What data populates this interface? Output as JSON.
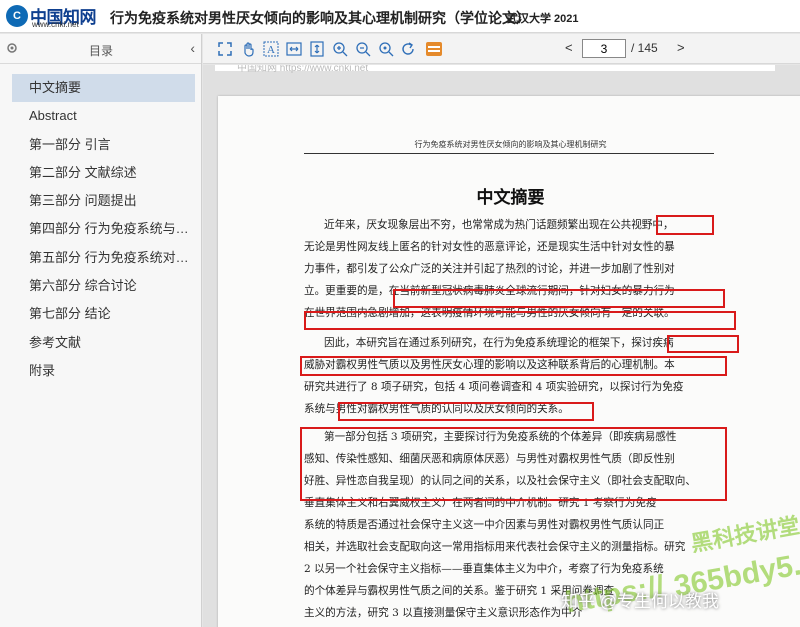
{
  "app": {
    "logo_text": "CNKi",
    "logo_brand": "中国知网",
    "logo_url": "www.cnki.net",
    "title": "行为免疫系统对男性厌女倾向的影响及其心理机制研究（学位论文）",
    "meta": "武汉大学 2021"
  },
  "sidebar": {
    "title": "目录",
    "items": [
      {
        "label": "中文摘要",
        "active": true,
        "expandable": false
      },
      {
        "label": "Abstract",
        "active": false,
        "expandable": false
      },
      {
        "label": "第一部分 引言",
        "active": false,
        "expandable": true
      },
      {
        "label": "第二部分 文献综述",
        "active": false,
        "expandable": true
      },
      {
        "label": "第三部分 问题提出",
        "active": false,
        "expandable": true
      },
      {
        "label": "第四部分 行为免疫系统与霸权...",
        "active": false,
        "expandable": true
      },
      {
        "label": "第五部分 行为免疫系统对厌女...",
        "active": false,
        "expandable": true
      },
      {
        "label": "第六部分 综合讨论",
        "active": false,
        "expandable": true
      },
      {
        "label": "第七部分 结论",
        "active": false,
        "expandable": false
      },
      {
        "label": "参考文献",
        "active": false,
        "expandable": false
      },
      {
        "label": "附录",
        "active": false,
        "expandable": false
      }
    ]
  },
  "toolbar": {
    "icons": [
      "fit-page-icon",
      "hand-tool-icon",
      "text-select-icon",
      "fit-width-icon",
      "fit-height-icon",
      "zoom-in-icon",
      "zoom-out-icon",
      "zoom-reset-icon",
      "rotate-icon",
      "bookmark-icon"
    ]
  },
  "pager": {
    "current": "3",
    "total": "/ 145",
    "prev": "<",
    "next": ">"
  },
  "document": {
    "prev_page_text": "中国知网   https://www.cnki.net",
    "running_head": "行为免疫系统对男性厌女倾向的影响及其心理机制研究",
    "abstract_title": "中文摘要",
    "lines": [
      "近年来，厌女现象层出不穷，也常常成为热门话题频繁出现在公共视野中，",
      "无论是男性网友线上匿名的针对女性的恶意评论，还是现实生活中针对女性的暴",
      "力事件，都引发了公众广泛的关注并引起了热烈的讨论，并进一步加剧了性别对",
      "立。更重要的是，在当前新型冠状病毒肺炎全球流行期间，针对妇女的暴力行为",
      "在世界范围内急剧增加，这表明疫情环境可能与男性的厌女倾向有一定的关联。",
      "因此，本研究旨在通过系列研究，在行为免疫系统理论的框架下，探讨疾病",
      "威胁对霸权男性气质以及男性厌女心理的影响以及这种联系背后的心理机制。本",
      "研究共进行了 8 项子研究，包括 4 项问卷调查和 4 项实验研究，以探讨行为免疫",
      "系统与男性对霸权男性气质的认同以及厌女倾向的关系。",
      "第一部分包括 3 项研究，主要探讨行为免疫系统的个体差异（即疾病易感性",
      "感知、传染性感知、细菌厌恶和病原体厌恶）与男性对霸权男性气质（即反性别",
      "好胜、异性恋自我呈现）的认同之间的关系，以及社会保守主义（即社会支配取向、",
      "垂直集体主义和右翼威权主义）在两者间的中介机制。研究 1 考察行为免疫",
      "系统的特质是否通过社会保守主义这一中介因素与男性对霸权男性气质认同正",
      "相关，并选取社会支配取向这一常用指标用来代表社会保守主义的测量指标。研究",
      "2 以另一个社会保守主义指标——垂直集体主义为中介，考察了行为免疫系统",
      "的个体差异与霸权男性气质之间的关系。鉴于研究 1 采用问卷调查",
      "主义的方法，研究 3 以直接测量保守主义意识形态作为中介"
    ]
  },
  "watermarks": {
    "wm1": "黑科技讲堂",
    "wm2": "365bdy5.com",
    "wm3": "https://",
    "zhihu": "知乎 @专生何以教我"
  },
  "colors": {
    "accent": "#2f6fb8",
    "highlight_box": "#d91a1a",
    "active_item": "#d0dcea"
  }
}
